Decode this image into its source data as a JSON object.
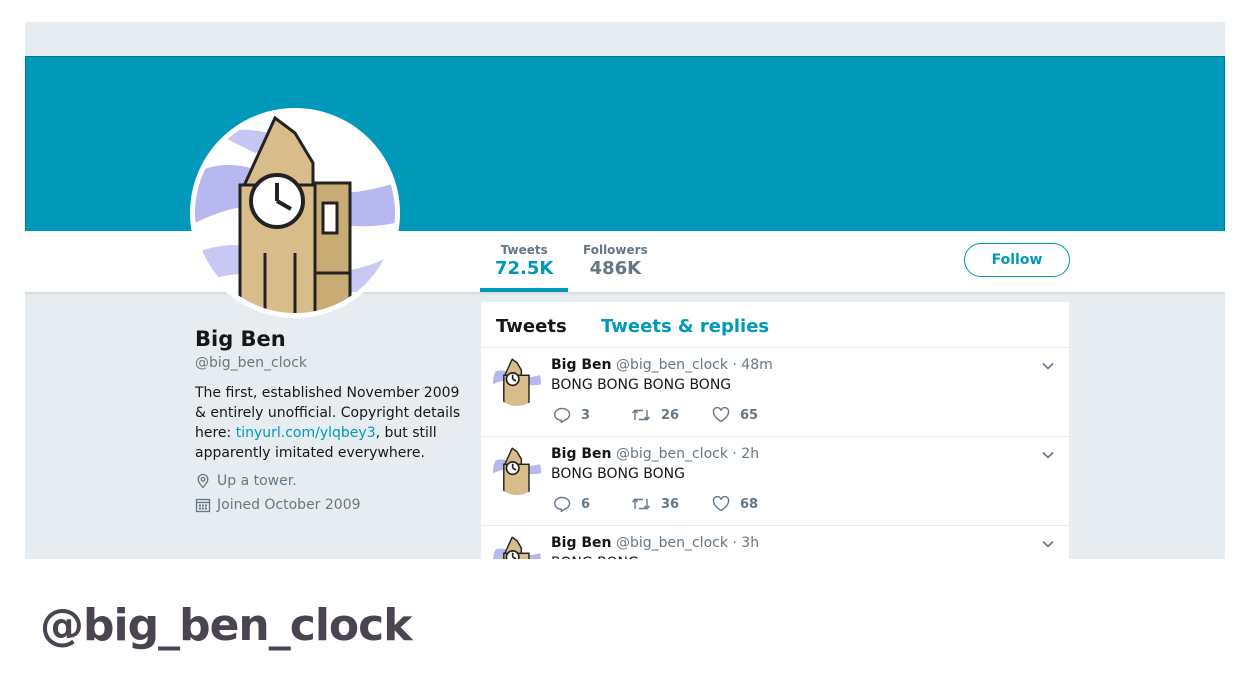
{
  "colors": {
    "accent": "#0099b9",
    "banner": "#0099b9",
    "muted": "#657786",
    "text": "#14171a"
  },
  "profile_nav": {
    "tweets_label": "Tweets",
    "tweets_value": "72.5K",
    "followers_label": "Followers",
    "followers_value": "486K",
    "follow_label": "Follow"
  },
  "profile": {
    "name": "Big Ben",
    "handle": "@big_ben_clock",
    "bio_before": "The first, established November 2009 & entirely unofficial. Copyright details here: ",
    "bio_link": "tinyurl.com/ylqbey3",
    "bio_after": ", but still apparently imitated everywhere.",
    "location": "Up a tower.",
    "joined": "Joined October 2009",
    "location_icon": "location-pin-icon",
    "joined_icon": "calendar-icon"
  },
  "timeline": {
    "tab_tweets": "Tweets",
    "tab_replies": "Tweets & replies",
    "tweets": [
      {
        "name": "Big Ben",
        "handle": "@big_ben_clock",
        "time": "· 48m",
        "text": "BONG BONG BONG BONG",
        "replies": "3",
        "retweets": "26",
        "likes": "65"
      },
      {
        "name": "Big Ben",
        "handle": "@big_ben_clock",
        "time": "· 2h",
        "text": "BONG BONG BONG",
        "replies": "6",
        "retweets": "36",
        "likes": "68"
      },
      {
        "name": "Big Ben",
        "handle": "@big_ben_clock",
        "time": "· 3h",
        "text": "BONG BONG",
        "replies": "",
        "retweets": "",
        "likes": ""
      }
    ]
  },
  "caption": "@big_ben_clock"
}
